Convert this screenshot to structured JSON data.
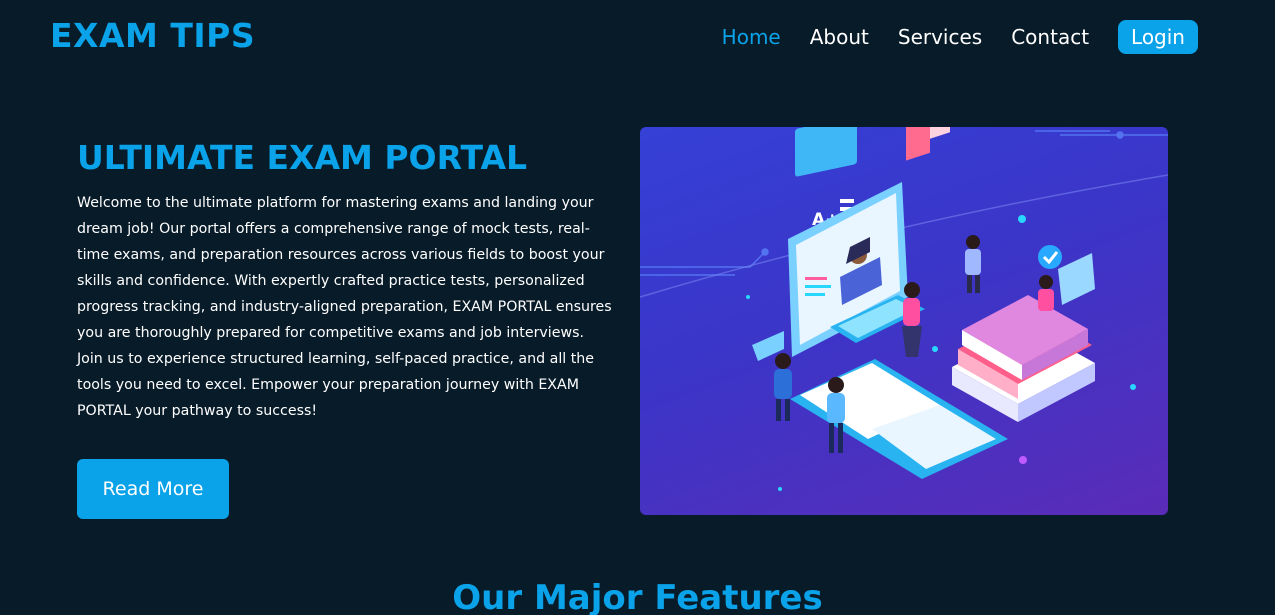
{
  "header": {
    "logo": "EXAM TIPS",
    "nav": {
      "home": "Home",
      "about": "About",
      "services": "Services",
      "contact": "Contact",
      "login": "Login"
    }
  },
  "hero": {
    "title": "ULTIMATE EXAM PORTAL",
    "text": "Welcome to the ultimate platform for mastering exams and landing your dream job! Our portal offers a comprehensive range of mock tests, real-time exams, and preparation resources across various fields to boost your skills and confidence. With expertly crafted practice tests, personalized progress tracking, and industry-aligned preparation, EXAM PORTAL ensures you are thoroughly prepared for competitive exams and job interviews. Join us to experience structured learning, self-paced practice, and all the tools you need to excel. Empower your preparation journey with EXAM PORTAL your pathway to success!",
    "button": "Read More",
    "illustration_grade": "A+"
  },
  "features": {
    "title": "Our Major Features"
  },
  "colors": {
    "background": "#081b29",
    "accent": "#0aa2e8",
    "text": "#ffffff"
  }
}
